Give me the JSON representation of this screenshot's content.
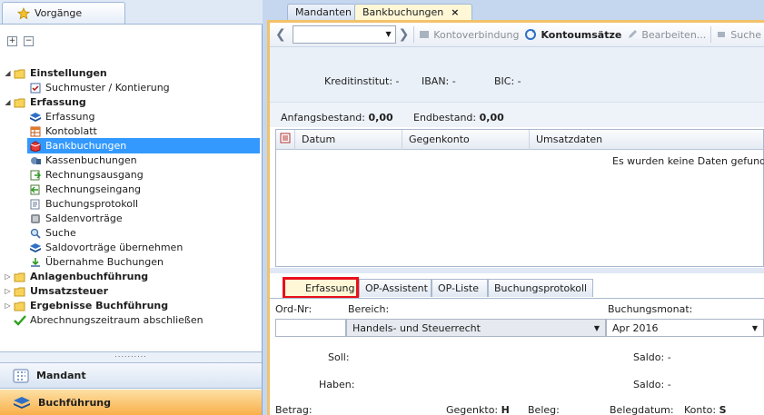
{
  "left_panel": {
    "header_tab": "Vorgänge",
    "tree": [
      {
        "label": "Einstellungen",
        "level": 0,
        "bold": true,
        "expanded": true,
        "icon": "folder-icon"
      },
      {
        "label": "Suchmuster / Kontierung",
        "level": 1,
        "icon": "checkbox-doc-icon"
      },
      {
        "label": "Erfassung",
        "level": 0,
        "bold": true,
        "expanded": true,
        "icon": "folder-icon"
      },
      {
        "label": "Erfassung",
        "level": 1,
        "icon": "book-icon"
      },
      {
        "label": "Kontoblatt",
        "level": 1,
        "icon": "grid-sheet-icon"
      },
      {
        "label": "Bankbuchungen",
        "level": 1,
        "icon": "bank-box-icon",
        "selected": true
      },
      {
        "label": "Kassenbuchungen",
        "level": 1,
        "icon": "cash-register-icon"
      },
      {
        "label": "Rechnungsausgang",
        "level": 1,
        "icon": "invoice-out-icon"
      },
      {
        "label": "Rechnungseingang",
        "level": 1,
        "icon": "invoice-in-icon"
      },
      {
        "label": "Buchungsprotokoll",
        "level": 1,
        "icon": "protocol-icon"
      },
      {
        "label": "Saldenvorträge",
        "level": 1,
        "icon": "balance-icon"
      },
      {
        "label": "Suche",
        "level": 1,
        "icon": "search-icon"
      },
      {
        "label": "Saldovorträge übernehmen",
        "level": 1,
        "icon": "book-transfer-icon"
      },
      {
        "label": "Übernahme Buchungen",
        "level": 1,
        "icon": "import-bookings-icon"
      },
      {
        "label": "Anlagenbuchführung",
        "level": 0,
        "bold": true,
        "expanded": false,
        "icon": "folder-icon"
      },
      {
        "label": "Umsatzsteuer",
        "level": 0,
        "bold": true,
        "expanded": false,
        "icon": "folder-icon"
      },
      {
        "label": "Ergebnisse Buchführung",
        "level": 0,
        "bold": true,
        "expanded": false,
        "icon": "folder-icon"
      },
      {
        "label": "Abrechnungszeitraum abschließen",
        "level": 0,
        "icon": "check-icon"
      }
    ],
    "grip": "..........",
    "nav": {
      "mandant": "Mandant",
      "buchfuehrung": "Buchführung"
    }
  },
  "tabs": {
    "mandanten": "Mandanten",
    "bankbuchungen": "Bankbuchungen",
    "close": "×"
  },
  "toolbar": {
    "kontoverbindung": "Kontoverbindung",
    "kontoumsaetze": "Kontoumsätze",
    "bearbeiten": "Bearbeiten...",
    "suche": "Suche"
  },
  "bank_info": {
    "kreditinstitut": "Kreditinstitut: -",
    "iban": "IBAN: -",
    "bic": "BIC: -"
  },
  "balances": {
    "anfang_label": "Anfangsbestand:",
    "anfang_value": "0,00",
    "end_label": "Endbestand:",
    "end_value": "0,00"
  },
  "grid": {
    "columns": [
      "Datum",
      "Gegenkonto",
      "Umsatzdaten"
    ],
    "empty_message": "Es wurden keine Daten gefunden"
  },
  "subtabs": [
    "Erfassung",
    "OP-Assistent",
    "OP-Liste",
    "Buchungsprotokoll"
  ],
  "form": {
    "ord_nr": "Ord-Nr:",
    "bereich_label": "Bereich:",
    "bereich_value": "Handels- und Steuerrecht",
    "monat_label": "Buchungsmonat:",
    "monat_value": "Apr 2016",
    "soll": "Soll:",
    "haben": "Haben:",
    "saldo1": "Saldo: -",
    "saldo2": "Saldo: -",
    "betrag": "Betrag:",
    "gegenkonto": "Gegenkto:",
    "gegenkonto_mode": "H",
    "beleg": "Beleg:",
    "belegdatum": "Belegdatum:",
    "konto": "Konto:",
    "konto_mode": "S"
  },
  "colors": {
    "accent": "#f2c26a",
    "selection": "#3399ff",
    "highlight_red": "#e8101b"
  }
}
